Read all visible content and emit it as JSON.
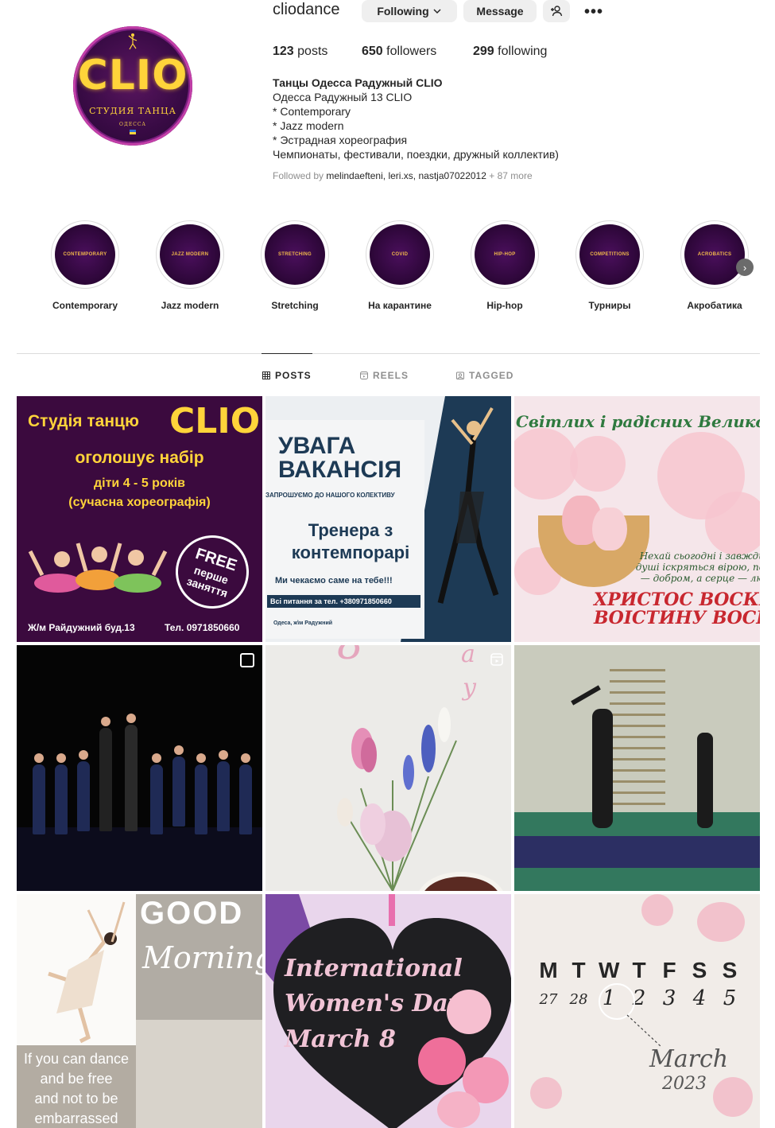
{
  "profile": {
    "username": "cliodance",
    "following_button": "Following",
    "message_button": "Message",
    "avatar": {
      "logo_text": "CLIO",
      "subtitle": "СТУДИЯ ТАНЦА",
      "city": "ОДЕССА"
    },
    "stats": {
      "posts_count": "123",
      "posts_label": "posts",
      "followers_count": "650",
      "followers_label": "followers",
      "following_count": "299",
      "following_label": "following"
    },
    "bio": {
      "name": "Танцы Одесса Радужный CLIO",
      "lines": [
        "Одесса Радужный 13 CLIO",
        "* Contemporary",
        "* Jazz modern",
        "* Эстрадная хореография",
        "Чемпионаты, фестивали, поездки, дружный коллектив)"
      ]
    },
    "followed_by": {
      "prefix": "Followed by",
      "users": [
        "melindaefteni",
        "leri.xs",
        "nastja07022012"
      ],
      "more": "+ 87 more"
    }
  },
  "highlights": [
    {
      "cover": "CONTEMPORARY",
      "label": "Contemporary"
    },
    {
      "cover": "JAZZ MODERN",
      "label": "Jazz modern"
    },
    {
      "cover": "STRETCHING",
      "label": "Stretching"
    },
    {
      "cover": "COVID",
      "label": "На карантине"
    },
    {
      "cover": "HIP-HOP",
      "label": "Hip-hop"
    },
    {
      "cover": "COMPETITIONS",
      "label": "Турниры"
    },
    {
      "cover": "ACROBATICS",
      "label": "Акробатика"
    }
  ],
  "tabs": {
    "posts": "POSTS",
    "reels": "REELS",
    "tagged": "TAGGED"
  },
  "posts": {
    "p1": {
      "title": "Студія танцю",
      "logo": "CLIO",
      "line1": "оголошує набір",
      "line2": "діти 4 - 5 років",
      "line3": "(сучасна хореографія)",
      "free1": "FREE",
      "free2": "перше",
      "free3": "заняття",
      "address": "Ж/м Райдужний буд.13",
      "phone": "Тел. 0971850660"
    },
    "p2": {
      "heading1": "УВАГА",
      "heading2": "ВАКАНСІЯ",
      "sub": "ЗАПРОШУЄМО ДО НАШОГО КОЛЕКТИВУ",
      "role1": "Тренера з",
      "role2": "контемпорарі",
      "wait": "Ми чекаємо саме на тебе!!!",
      "phone": "Всі питання за тел. +380971850660",
      "city": "Одеса, ж\\м Радужний"
    },
    "p3": {
      "greeting": "Світлих і радісних Великодніх Св",
      "wish1": "Нехай сьогодні і завжди",
      "wish2": "душі іскряться вірою, по",
      "wish3": "— добром, а серце — лю",
      "xv1": "ХРИСТОС ВОСКРЕ",
      "xv2": "ВОІСТИНУ ВОСКРЕ"
    },
    "p7": {
      "good": "GOOD",
      "morning": "Morning",
      "quote": [
        "If you can dance",
        "and be free",
        "and not to be",
        "embarrassed"
      ]
    },
    "p8": {
      "line1": "International",
      "line2": "Women's Day",
      "line3": "March 8"
    },
    "p9": {
      "days": [
        "M",
        "T",
        "W",
        "T",
        "F",
        "S",
        "S"
      ],
      "nums": [
        "27",
        "28",
        "1",
        "2",
        "3",
        "4",
        "5"
      ],
      "month": "March",
      "year": "2023"
    }
  },
  "colors": {
    "brand_purple": "#3b0a3e",
    "brand_gold": "#ffd43a",
    "button_bg": "#efefef",
    "text_primary": "#262626",
    "text_secondary": "#8e8e8e"
  }
}
